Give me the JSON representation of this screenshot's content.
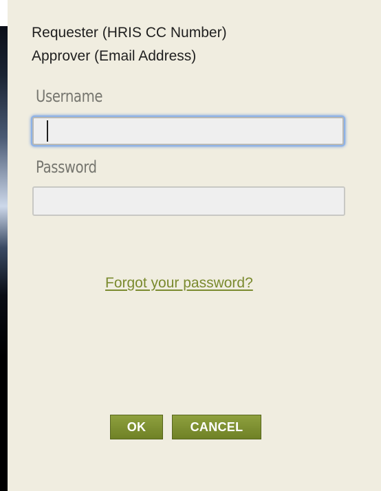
{
  "info": {
    "line1": "Requester (HRIS CC Number)",
    "line2": "Approver (Email Address)"
  },
  "login": {
    "username_label": "Username",
    "username_value": "",
    "password_label": "Password",
    "password_value": "",
    "forgot_link": "Forgot your password?"
  },
  "buttons": {
    "ok": "OK",
    "cancel": "CANCEL"
  },
  "colors": {
    "panel_bg": "#f0ede0",
    "button_green": "#7a8c2f",
    "link_green": "#7a8a2e",
    "focus_ring": "#6d98dc"
  }
}
